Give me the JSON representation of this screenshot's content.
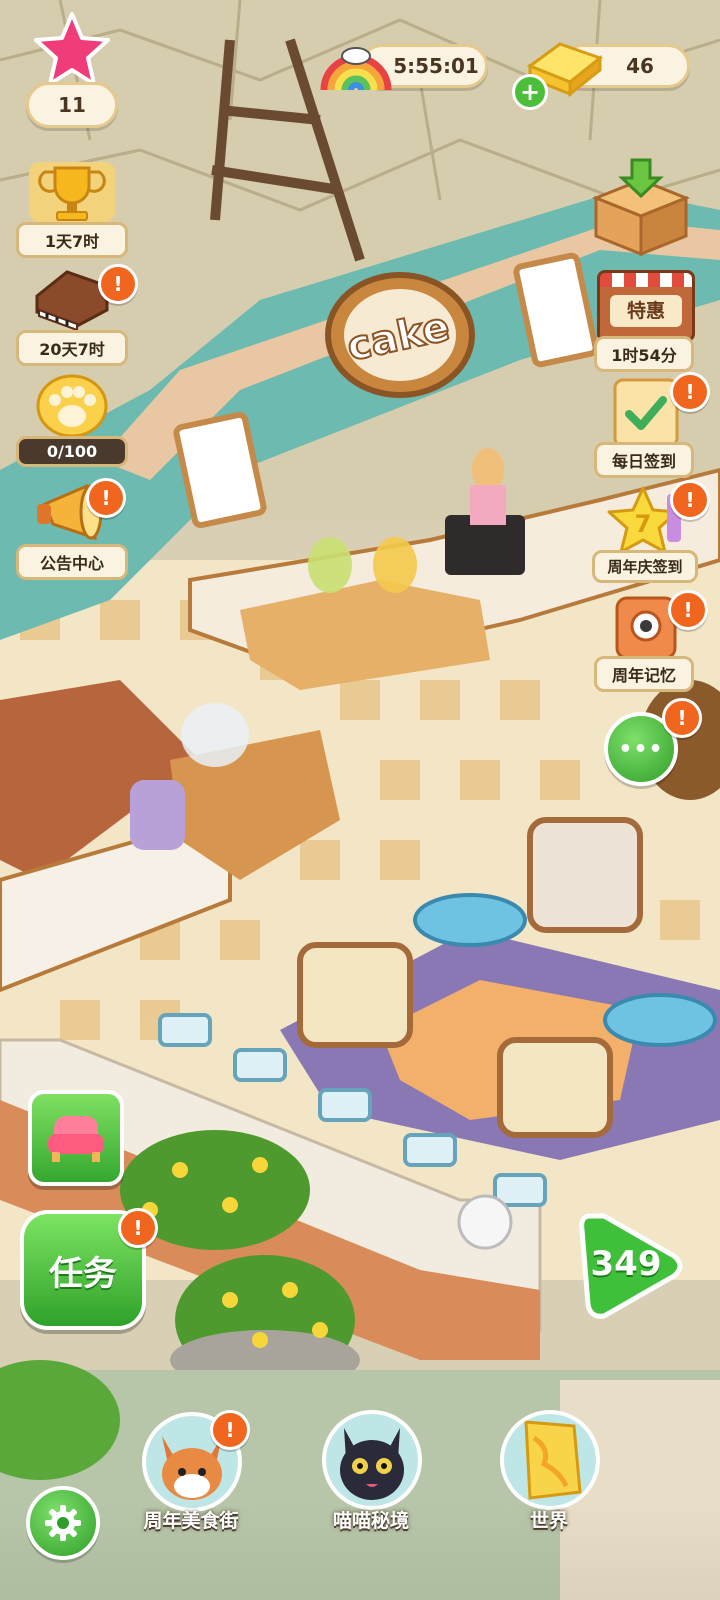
{
  "hud": {
    "stars": "11",
    "timer": "5:55:01",
    "gold": "46"
  },
  "left_menu": [
    {
      "id": "trophy",
      "label": "1天7时"
    },
    {
      "id": "piano",
      "label": "20天7时"
    },
    {
      "id": "paw",
      "label": "0/100"
    },
    {
      "id": "announce",
      "label": "公告中心"
    }
  ],
  "right_menu": [
    {
      "id": "box",
      "label": ""
    },
    {
      "id": "shop",
      "sign": "特惠",
      "label": "1时54分"
    },
    {
      "id": "daily",
      "label": "每日签到"
    },
    {
      "id": "anniv_sign",
      "label": "周年庆签到"
    },
    {
      "id": "memory",
      "label": "周年记忆"
    }
  ],
  "more_button": "•••",
  "task_button": "任务",
  "level_button": "349",
  "bottom_nav": [
    {
      "id": "street",
      "label": "周年美食街"
    },
    {
      "id": "cat",
      "label": "喵喵秘境"
    },
    {
      "id": "world",
      "label": "世界"
    }
  ],
  "scene_sign": "cake",
  "alert_glyph": "!"
}
